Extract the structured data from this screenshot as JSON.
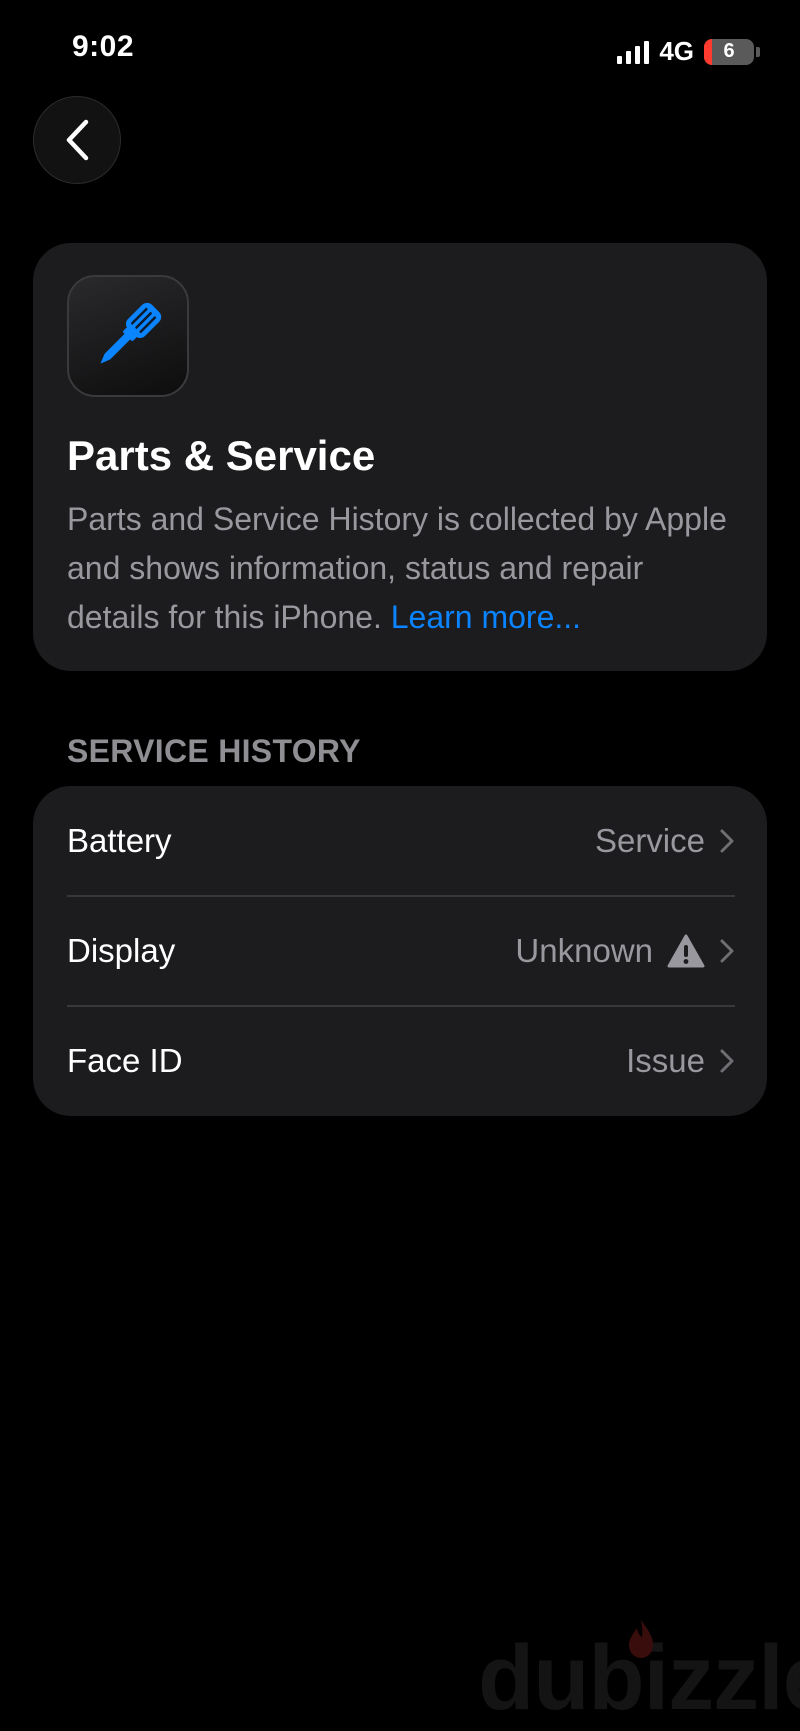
{
  "status_bar": {
    "time": "9:02",
    "network": "4G",
    "battery_level": "6"
  },
  "info_card": {
    "icon": "screwdriver-icon",
    "title": "Parts & Service",
    "description": "Parts and Service History is collected by Apple and shows information, status and repair details for this iPhone. ",
    "learn_more": "Learn more..."
  },
  "service_history": {
    "header": "SERVICE HISTORY",
    "items": [
      {
        "label": "Battery",
        "value": "Service",
        "warning": false
      },
      {
        "label": "Display",
        "value": "Unknown",
        "warning": true
      },
      {
        "label": "Face ID",
        "value": "Issue",
        "warning": false
      }
    ]
  },
  "watermark": "dubizzle",
  "colors": {
    "accent": "#0a84ff",
    "card": "#1c1c1e",
    "background": "#000000",
    "secondary_text": "#98989e"
  }
}
